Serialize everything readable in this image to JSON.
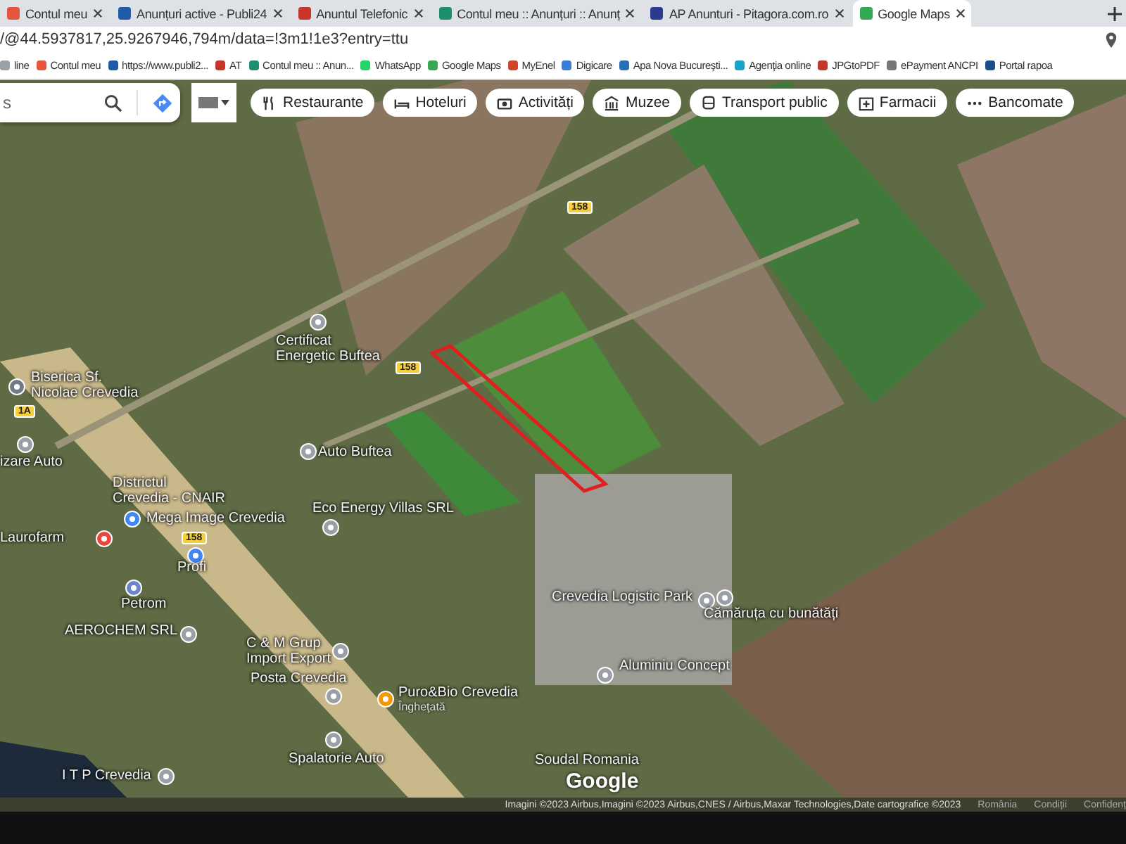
{
  "tabs": [
    {
      "title": "Contul meu",
      "color": "#e8553f",
      "selected": false
    },
    {
      "title": "Anunțuri active - Publi24",
      "color": "#1f5ba8",
      "selected": false
    },
    {
      "title": "Anuntul Telefonic",
      "color": "#c8352a",
      "selected": false
    },
    {
      "title": "Contul meu :: Anunțuri :: Anunț",
      "color": "#1e8f6e",
      "selected": false
    },
    {
      "title": "AP Anunturi - Pitagora.com.ro",
      "color": "#2b3a8f",
      "selected": false
    },
    {
      "title": "Google Maps",
      "color": "#34a853",
      "selected": true
    }
  ],
  "address": "/@44.5937817,25.9267946,794m/data=!3m1!1e3?entry=ttu",
  "bookmarks": [
    {
      "label": "line",
      "color": "#9aa0a6"
    },
    {
      "label": "Contul meu",
      "color": "#e8553f"
    },
    {
      "label": "https://www.publi2...",
      "color": "#1f5ba8"
    },
    {
      "label": "AT",
      "color": "#c8352a"
    },
    {
      "label": "Contul meu :: Anun...",
      "color": "#1e8f6e"
    },
    {
      "label": "WhatsApp",
      "color": "#25d366"
    },
    {
      "label": "Google Maps",
      "color": "#34a853"
    },
    {
      "label": "MyEnel",
      "color": "#d0452c"
    },
    {
      "label": "Digicare",
      "color": "#3a7bd5"
    },
    {
      "label": "Apa Nova Bucureşti...",
      "color": "#2a6fb5"
    },
    {
      "label": "Agenţia online",
      "color": "#1aa3c9"
    },
    {
      "label": "JPGtoPDF",
      "color": "#c0392b"
    },
    {
      "label": "ePayment ANCPI",
      "color": "#777777"
    },
    {
      "label": "Portal rapoa",
      "color": "#1b4f8a"
    }
  ],
  "search": {
    "placeholder": "s"
  },
  "chips": [
    {
      "label": "Restaurante",
      "kind": "food"
    },
    {
      "label": "Hoteluri",
      "kind": "hotel"
    },
    {
      "label": "Activități",
      "kind": "camera"
    },
    {
      "label": "Muzee",
      "kind": "museum"
    },
    {
      "label": "Transport public",
      "kind": "bus"
    },
    {
      "label": "Farmacii",
      "kind": "pharmacy"
    },
    {
      "label": "Bancomate",
      "kind": "atm"
    }
  ],
  "places": [
    {
      "label": "Certificat\nEnergetic Buftea",
      "kind": "poi"
    },
    {
      "label": "Biserica Sf.\nNicolae Crevedia",
      "kind": "church"
    },
    {
      "label": "izare Auto",
      "kind": "poi"
    },
    {
      "label": "Auto Buftea",
      "kind": "poi"
    },
    {
      "label": "Districtul\nCrevedia - CNAIR",
      "kind": "none"
    },
    {
      "label": "Mega Image Crevedia",
      "kind": "shop"
    },
    {
      "label": "Eco Energy Villas SRL",
      "kind": "poi"
    },
    {
      "label": "Laurofarm",
      "kind": "pharmacy"
    },
    {
      "label": "Profi",
      "kind": "shop"
    },
    {
      "label": "Petrom",
      "kind": "fuel"
    },
    {
      "label": "AEROCHEM SRL",
      "kind": "poi"
    },
    {
      "label": "C & M Grup\nImport Export",
      "kind": "poi"
    },
    {
      "label": "Posta Crevedia",
      "kind": "poi"
    },
    {
      "label": "Puro&Bio Crevedia",
      "sub": "Îngheţată",
      "kind": "food"
    },
    {
      "label": "Spalatorie Auto",
      "kind": "poi"
    },
    {
      "label": "I T P Crevedia",
      "kind": "poi"
    },
    {
      "label": "Crevedia Logistic Park",
      "kind": "poi"
    },
    {
      "label": "Cămăruța cu bunătăți",
      "kind": "poi"
    },
    {
      "label": "Aluminiu Concept",
      "kind": "store"
    },
    {
      "label": "Soudal Romania",
      "kind": "none"
    }
  ],
  "road_shields": [
    "158",
    "158",
    "158",
    "1A"
  ],
  "logo": "Google",
  "footer": {
    "attribution": "Imagini ©2023 Airbus,Imagini ©2023 Airbus,CNES / Airbus,Maxar Technologies,Date cartografice ©2023",
    "links": [
      "România",
      "Condiții",
      "Confidenț"
    ]
  }
}
